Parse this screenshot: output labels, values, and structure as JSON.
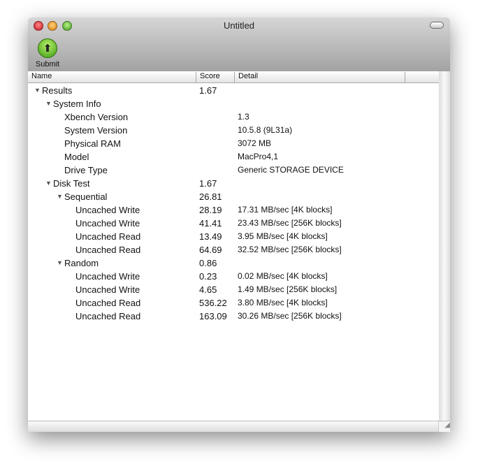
{
  "window": {
    "title": "Untitled"
  },
  "toolbar": {
    "submit_label": "Submit"
  },
  "columns": [
    "Name",
    "Score",
    "Detail"
  ],
  "rows": [
    {
      "level": 0,
      "expanded": true,
      "name": "Results",
      "score": "1.67",
      "detail": ""
    },
    {
      "level": 1,
      "expanded": true,
      "name": "System Info",
      "score": "",
      "detail": ""
    },
    {
      "level": 2,
      "name": "Xbench Version",
      "score": "",
      "detail": "1.3"
    },
    {
      "level": 2,
      "name": "System Version",
      "score": "",
      "detail": "10.5.8 (9L31a)"
    },
    {
      "level": 2,
      "name": "Physical RAM",
      "score": "",
      "detail": "3072 MB"
    },
    {
      "level": 2,
      "name": "Model",
      "score": "",
      "detail": "MacPro4,1"
    },
    {
      "level": 2,
      "name": "Drive Type",
      "score": "",
      "detail": "Generic STORAGE DEVICE"
    },
    {
      "level": 1,
      "expanded": true,
      "name": "Disk Test",
      "score": "1.67",
      "detail": ""
    },
    {
      "level": 2,
      "expanded": true,
      "name": "Sequential",
      "score": "26.81",
      "detail": ""
    },
    {
      "level": 3,
      "name": "Uncached Write",
      "score": "28.19",
      "detail": "17.31 MB/sec [4K blocks]"
    },
    {
      "level": 3,
      "name": "Uncached Write",
      "score": "41.41",
      "detail": "23.43 MB/sec [256K blocks]"
    },
    {
      "level": 3,
      "name": "Uncached Read",
      "score": "13.49",
      "detail": "3.95 MB/sec [4K blocks]"
    },
    {
      "level": 3,
      "name": "Uncached Read",
      "score": "64.69",
      "detail": "32.52 MB/sec [256K blocks]"
    },
    {
      "level": 2,
      "expanded": true,
      "name": "Random",
      "score": "0.86",
      "detail": ""
    },
    {
      "level": 3,
      "name": "Uncached Write",
      "score": "0.23",
      "detail": "0.02 MB/sec [4K blocks]"
    },
    {
      "level": 3,
      "name": "Uncached Write",
      "score": "4.65",
      "detail": "1.49 MB/sec [256K blocks]"
    },
    {
      "level": 3,
      "name": "Uncached Read",
      "score": "536.22",
      "detail": "3.80 MB/sec [4K blocks]"
    },
    {
      "level": 3,
      "name": "Uncached Read",
      "score": "163.09",
      "detail": "30.26 MB/sec [256K blocks]"
    }
  ]
}
